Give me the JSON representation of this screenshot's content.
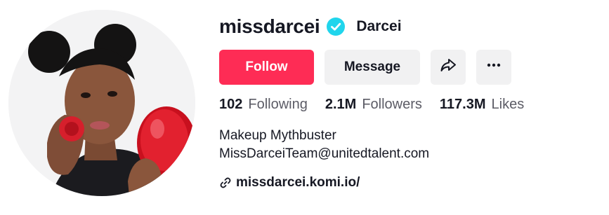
{
  "profile": {
    "username": "missdarcei",
    "nickname": "Darcei",
    "verified": true,
    "avatar_alt": "Profile photo"
  },
  "actions": {
    "follow_label": "Follow",
    "message_label": "Message",
    "share_icon": "share-arrow-icon",
    "more_icon": "ellipsis-icon"
  },
  "stats": [
    {
      "value": "102",
      "label": "Following"
    },
    {
      "value": "2.1M",
      "label": "Followers"
    },
    {
      "value": "117.3M",
      "label": "Likes"
    }
  ],
  "bio": {
    "line1": "Makeup Mythbuster",
    "line2": "MissDarceiTeam@unitedtalent.com"
  },
  "link": {
    "text": "missdarcei.komi.io/",
    "icon": "link-icon"
  },
  "colors": {
    "follow_bg": "#fe2c55",
    "secondary_bg": "#f1f1f2",
    "verified": "#20d5ec",
    "text": "#161823",
    "muted": "#5c5c66"
  }
}
